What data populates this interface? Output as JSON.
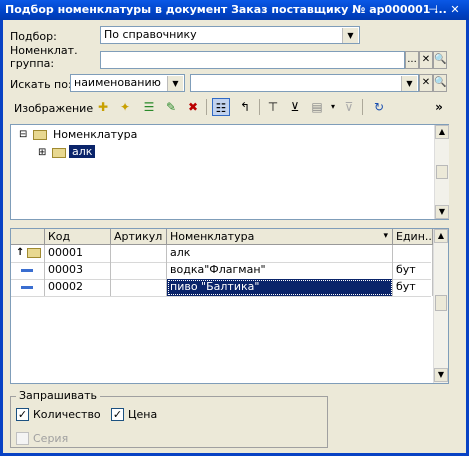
{
  "window": {
    "title": "Подбор номенклатуры в документ Заказ поставщику № ар000001 ...",
    "pin_icon": "pin-icon",
    "close_icon": "close-icon",
    "pin_glyph": "⊣",
    "close_glyph": "✕"
  },
  "form": {
    "selection_label": "Подбор:",
    "selection_value": "По справочнику",
    "group_label": "Номенклат. группа:",
    "group_value": "",
    "search_label": "Искать по:",
    "search_field_value": "наименованию",
    "search_text": "",
    "dots_glyph": "...",
    "x_glyph": "✕",
    "find_glyph": "🔍"
  },
  "toolbar": {
    "image_label": "Изображение",
    "more_glyph": "»",
    "more2_glyph": "▾"
  },
  "tree": {
    "root_label": "Номенклатура",
    "child_label": "алк",
    "root_toggle": "⊟",
    "child_toggle": "⊞"
  },
  "grid": {
    "columns": [
      "Код",
      "Артикул",
      "Номенклатура",
      "Един..."
    ],
    "sort_glyph": "▾",
    "rows": [
      {
        "code": "00001",
        "article": "",
        "name": "алк",
        "unit": "",
        "icon": "up-folder-icon",
        "glyph": "↑"
      },
      {
        "code": "00003",
        "article": "",
        "name": "водка\"Флагман\"",
        "unit": "бут",
        "icon": "item-icon"
      },
      {
        "code": "00002",
        "article": "",
        "name": "пиво \"Балтика\"",
        "unit": "бут",
        "icon": "item-icon"
      }
    ]
  },
  "ask": {
    "legend": "Запрашивать",
    "quantity_label": "Количество",
    "quantity_checked": true,
    "price_label": "Цена",
    "price_checked": true,
    "series_label": "Серия",
    "series_checked": false,
    "check_glyph": "✓"
  },
  "colors": {
    "title_bar": "#0a58e6",
    "selection": "#0a246a",
    "window_bg": "#ece9d8"
  }
}
